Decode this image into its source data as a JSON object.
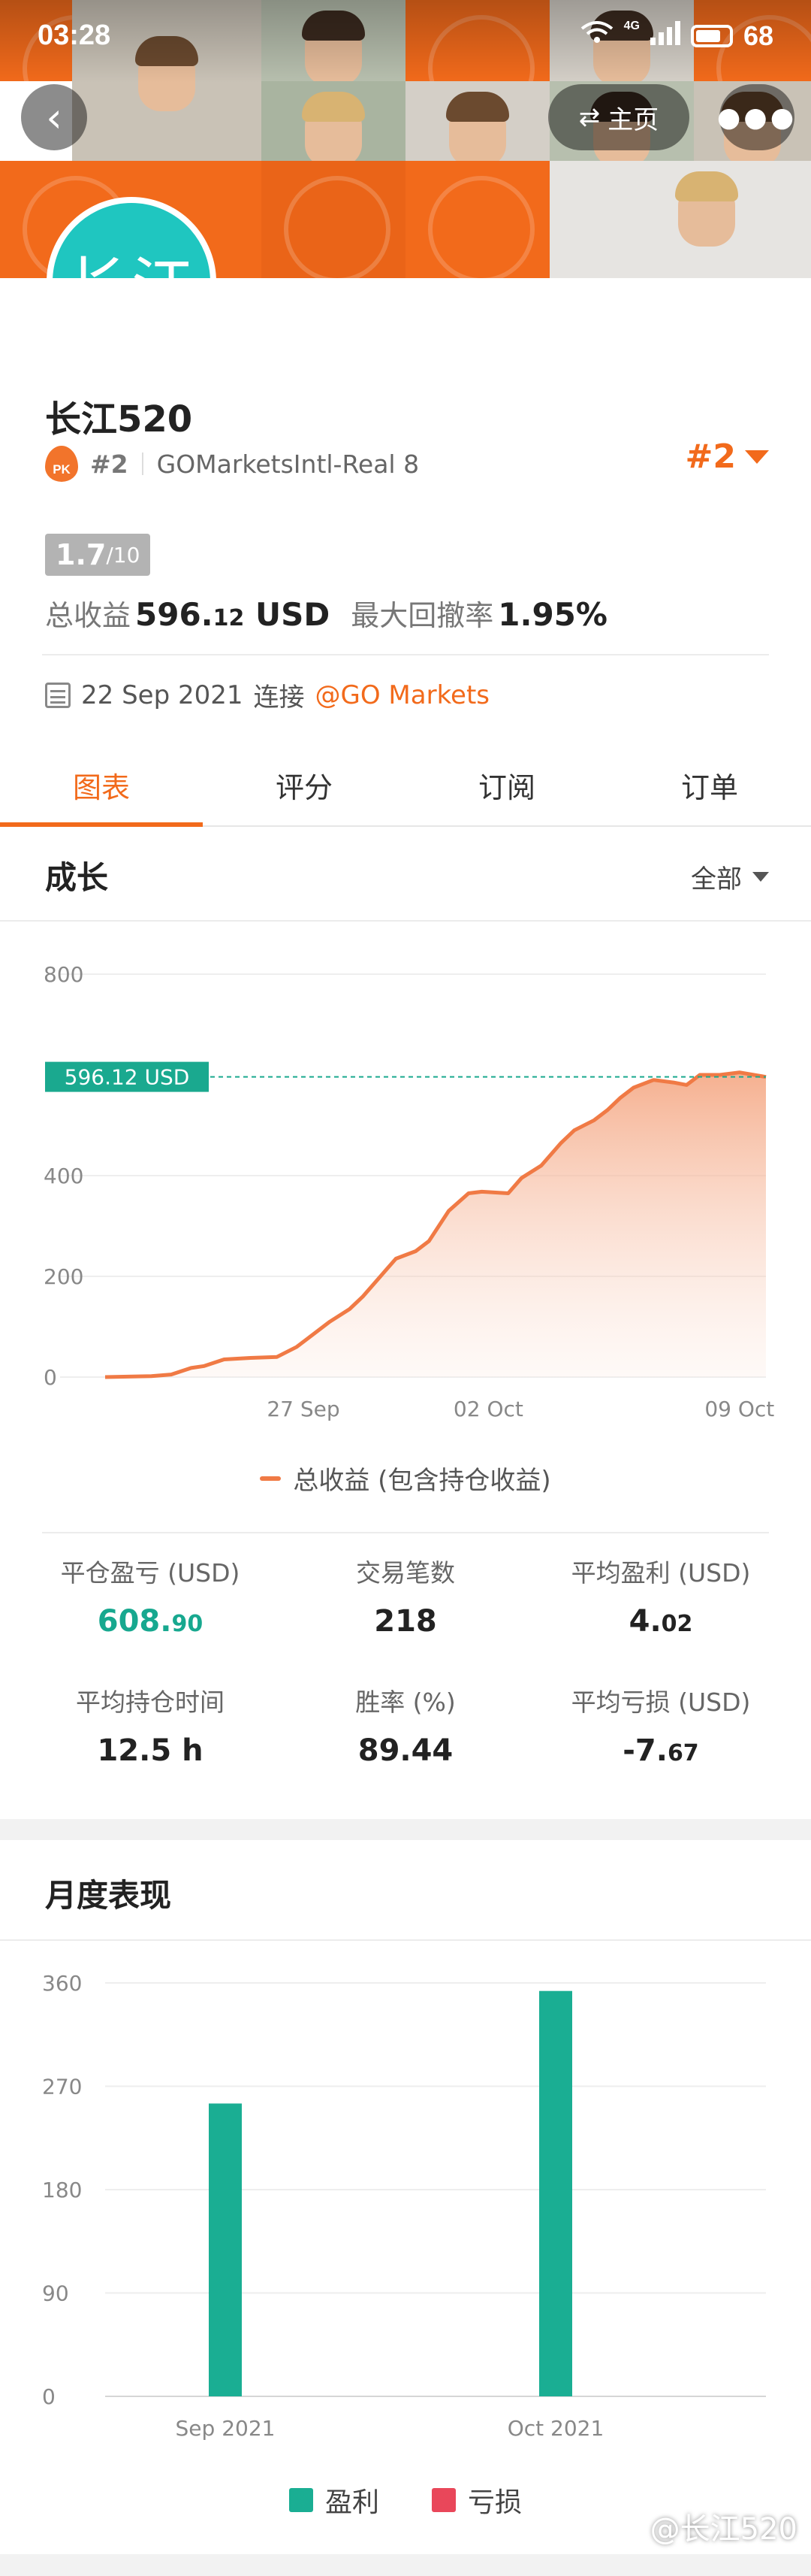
{
  "status_bar": {
    "time": "03:28",
    "network": "4G",
    "battery": "68"
  },
  "header": {
    "back_icon": "chevron-left-icon",
    "home_label": "主页",
    "home_icon": "swap-icon",
    "more_icon": "more-dots-icon",
    "avatar_text": "长江"
  },
  "profile": {
    "name": "长江520",
    "rank": "#2",
    "account": "GOMarketsIntl-Real 8",
    "rank_right": "#2",
    "score": "1.7",
    "score_max": "/10",
    "total_profit_label": "总收益",
    "total_profit_main": "596.",
    "total_profit_cents": "12",
    "total_profit_unit": "USD",
    "max_drawdown_label": "最大回撤率",
    "max_drawdown": "1.95%",
    "join_date": "22 Sep 2021",
    "join_text": "连接",
    "broker": "@GO Markets"
  },
  "tabs": [
    "图表",
    "评分",
    "订阅",
    "订单"
  ],
  "growth": {
    "title": "成长",
    "range": "全部",
    "legend": "总收益 (包含持仓收益)",
    "current_label": "596.12 USD",
    "colors": {
      "line": "#f07a45",
      "marker": "#1aa98f"
    }
  },
  "chart_data": [
    {
      "type": "area",
      "title": "成长",
      "ylim": [
        0,
        800
      ],
      "yticks": [
        "800",
        "400",
        "200",
        "0"
      ],
      "xticks": [
        "27 Sep",
        "02 Oct",
        "09 Oct"
      ],
      "series": [
        {
          "name": "总收益 (包含持仓收益)",
          "x": [
            0,
            0.07,
            0.1,
            0.13,
            0.15,
            0.18,
            0.22,
            0.26,
            0.29,
            0.31,
            0.34,
            0.37,
            0.39,
            0.42,
            0.44,
            0.47,
            0.49,
            0.52,
            0.55,
            0.57,
            0.61,
            0.63,
            0.66,
            0.69,
            0.71,
            0.74,
            0.76,
            0.78,
            0.8,
            0.83,
            0.86,
            0.88,
            0.9,
            0.93,
            0.96,
            1.0
          ],
          "values": [
            0,
            2,
            5,
            18,
            22,
            35,
            38,
            40,
            60,
            80,
            110,
            135,
            160,
            205,
            235,
            250,
            270,
            330,
            365,
            368,
            365,
            395,
            420,
            465,
            490,
            510,
            530,
            555,
            575,
            590,
            585,
            580,
            600,
            600,
            605,
            596
          ]
        }
      ],
      "reference_line": 596.12
    },
    {
      "type": "bar",
      "title": "月度表现",
      "categories": [
        "Sep 2021",
        "Oct 2021"
      ],
      "ylim": [
        0,
        360
      ],
      "yticks": [
        "360",
        "270",
        "180",
        "90",
        "0"
      ],
      "series": [
        {
          "name": "盈利",
          "values": [
            255,
            353
          ]
        },
        {
          "name": "亏损",
          "values": [
            0,
            0
          ]
        }
      ]
    }
  ],
  "metrics": [
    {
      "label": "平仓盈亏 (USD)",
      "main": "608.",
      "small": "90",
      "green": true
    },
    {
      "label": "交易笔数",
      "main": "218",
      "small": "",
      "green": false
    },
    {
      "label": "平均盈利 (USD)",
      "main": "4.",
      "small": "02",
      "green": false
    },
    {
      "label": "平均持仓时间",
      "main": "12.5 h",
      "small": "",
      "green": false
    },
    {
      "label": "胜率 (%)",
      "main": "89.44",
      "small": "",
      "green": false
    },
    {
      "label": "平均亏损 (USD)",
      "main": "-7.",
      "small": "67",
      "green": false
    }
  ],
  "monthly": {
    "title": "月度表现",
    "legend_profit": "盈利",
    "legend_loss": "亏损",
    "colors": {
      "profit": "#1aae93",
      "loss": "#e9475a"
    }
  },
  "watermark": "@长江520"
}
